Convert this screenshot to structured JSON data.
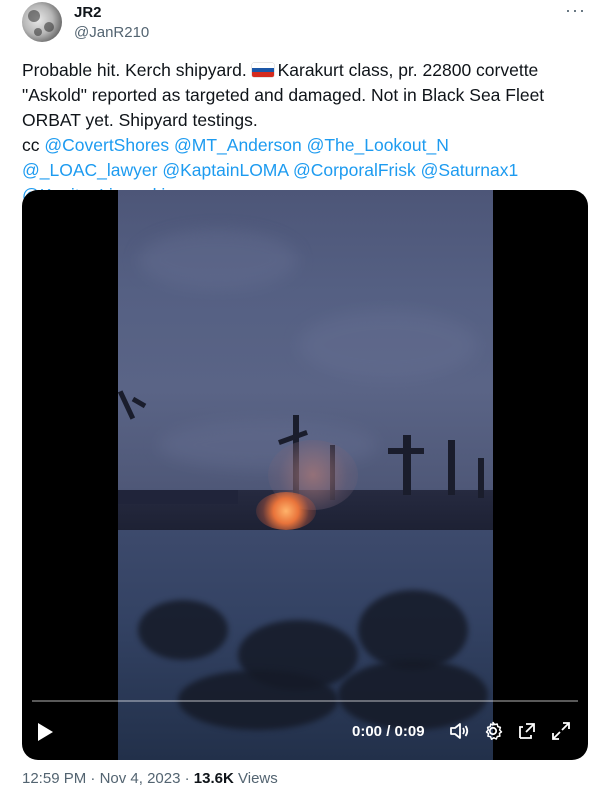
{
  "author": {
    "display_name": "JR2",
    "handle": "@JanR210"
  },
  "tweet": {
    "text_line1_a": "Probable hit. Kerch shipyard.",
    "flag_icon": "russia-flag",
    "text_line1_b": "Karakurt class, pr. 22800 corvette",
    "text_line2": "\"Askold\" reported as targeted and damaged. Not in Black Sea Fleet",
    "text_line3": "ORBAT yet. Shipyard testings.",
    "cc_prefix": "cc",
    "mentions": [
      "@CovertShores",
      "@MT_Anderson",
      "@The_Lookout_N",
      "@_LOAC_lawyer",
      "@KaptainLOMA",
      "@CorporalFrisk",
      "@Saturnax1",
      "@KapitanLisowski"
    ]
  },
  "video": {
    "time_display": "0:00 / 0:09",
    "progress_fraction": 0.0,
    "icons": [
      "play-icon",
      "volume-icon",
      "settings-icon",
      "pip-icon",
      "fullscreen-icon"
    ]
  },
  "meta": {
    "time": "12:59 PM",
    "separator": "·",
    "date": "Nov 4, 2023",
    "views_count": "13.6K",
    "views_label": "Views"
  },
  "colors": {
    "link": "#1d9bf0",
    "secondary_text": "#536471",
    "primary_text": "#0f1419"
  }
}
